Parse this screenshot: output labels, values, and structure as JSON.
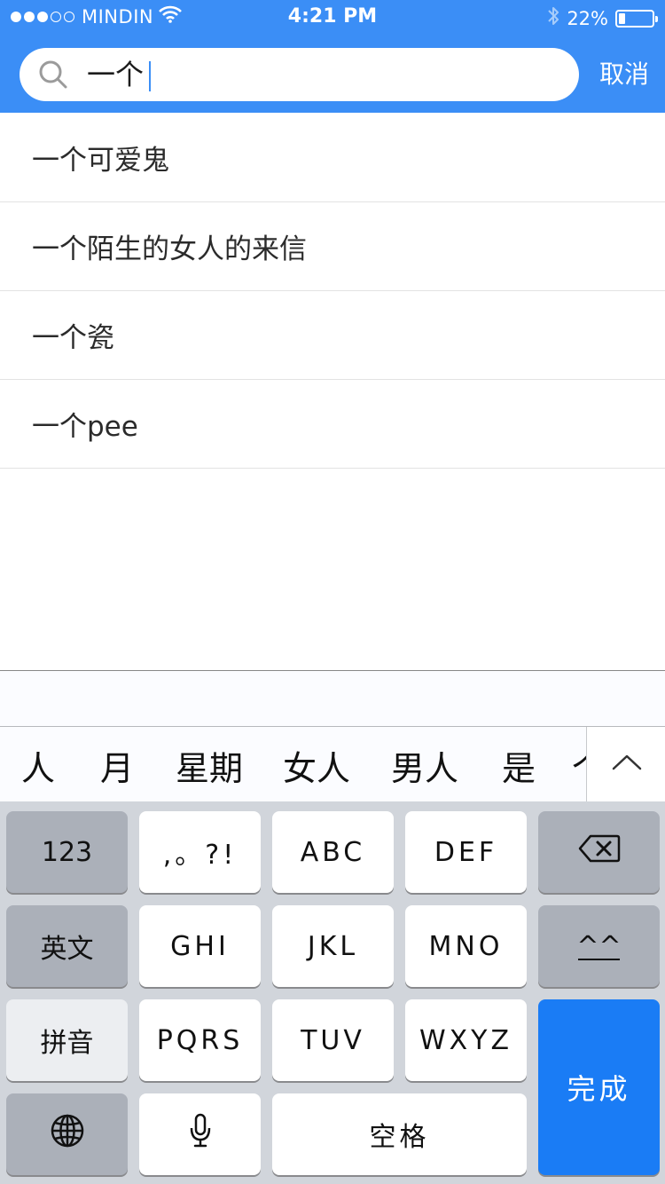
{
  "status_bar": {
    "carrier": "MINDIN",
    "time": "4:21 PM",
    "battery": "22%",
    "battery_level": 0.22
  },
  "search": {
    "value": "一个",
    "cancel_label": "取消"
  },
  "results": [
    {
      "label": "一个可爱鬼"
    },
    {
      "label": "一个陌生的女人的来信"
    },
    {
      "label": "一个瓷"
    },
    {
      "label": "一个pee"
    }
  ],
  "candidates": [
    "人",
    "月",
    "星期",
    "女人",
    "男人",
    "是",
    "个"
  ],
  "keyboard": {
    "row1": [
      "123",
      ",。?!",
      "ABC",
      "DEF"
    ],
    "row2": [
      "英文",
      "GHI",
      "JKL",
      "MNO",
      "^^"
    ],
    "row3": [
      "拼音",
      "PQRS",
      "TUV",
      "WXYZ"
    ],
    "space": "空格",
    "done": "完成"
  },
  "colors": {
    "header": "#3b8ef6",
    "done_key": "#1a7cf5",
    "keyboard_bg": "#d1d5db"
  },
  "icons": [
    "search-icon",
    "wifi-icon",
    "bluetooth-icon",
    "battery-icon",
    "chevron-up-icon",
    "backspace-icon",
    "globe-icon",
    "microphone-icon"
  ]
}
